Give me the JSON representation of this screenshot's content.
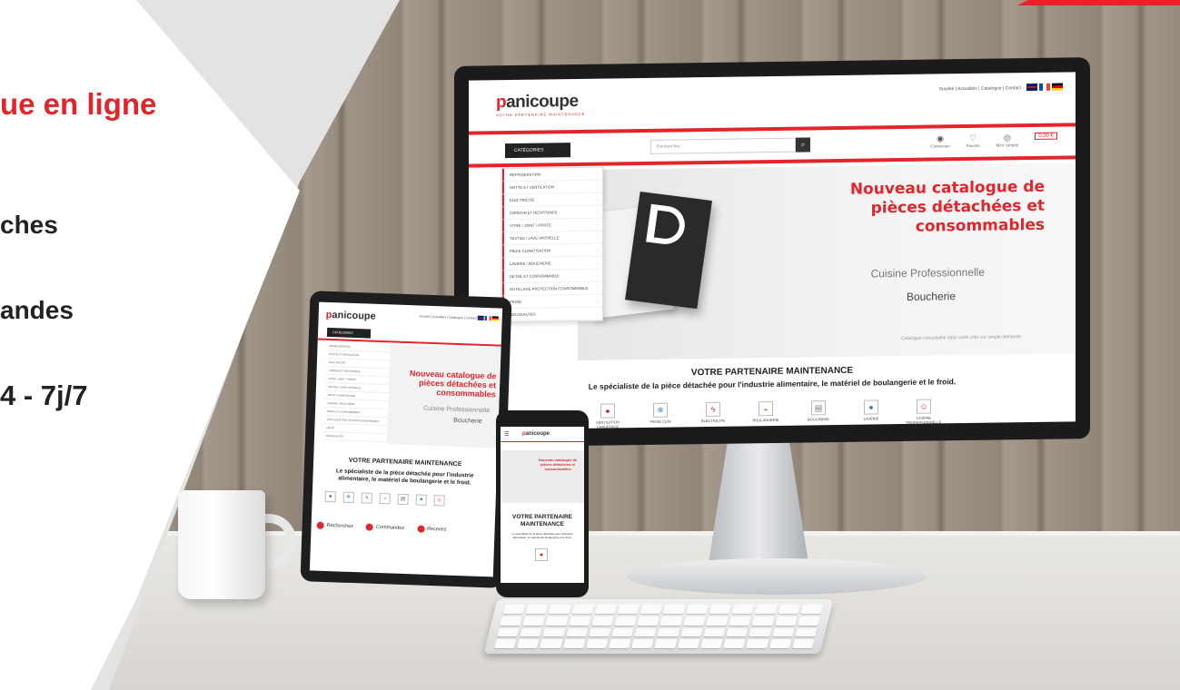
{
  "promo": {
    "line1": "ue en ligne",
    "line2": "ches",
    "line3": "andes",
    "line4": "4 - 7j/7"
  },
  "colors": {
    "brand_red": "#e2252b",
    "dark": "#222222"
  },
  "monitor": {
    "logo_main": "anicoupe",
    "logo_prefix": "p",
    "tagline": "VOTRE PARTENAIRE MAINTENANCE",
    "top_links": "Société | Actualités | Catalogue | Contact",
    "categories_button": "CATÉGORIES",
    "search_placeholder": "Rechercher...",
    "icons": [
      "Connexion",
      "Favoris",
      "Mon compte"
    ],
    "cart": "0,00 €",
    "menu": [
      "RÉFRIGÉRATION",
      "HOTTE ET VENTILATION",
      "ÉLECTRICITÉ",
      "CORDON ET RÉSISTANCE",
      "VITRE / JOINT / PORTE",
      "TEXTILE / LAVE-VAISSELLE",
      "PIÈCE CLIMATISATION",
      "LAVERIE / BOUCHERIE",
      "DÉTAIL ET CONSOMMABLE",
      "OUTILLAGE PROTECTION CONSOMMABLE",
      "FROID",
      "NOUVEAUTÉS"
    ],
    "banner_title": "Nouveau catalogue de pièces détachées et consommables",
    "banner_sub1": "Cuisine Professionnelle",
    "banner_sub2": "Boucherie",
    "banner_note": "Catalogue consultable dans votre colis sur simple demande",
    "partner_title": "VOTRE PARTENAIRE MAINTENANCE",
    "partner_desc": "Le spécialiste de la pièce détachée pour l'industrie alimentaire, le matériel de boulangerie et le froid.",
    "services": [
      {
        "label": "VENTILATION CHAUFFAGE",
        "icon": "flame-icon"
      },
      {
        "label": "FROID CLIM",
        "icon": "snowflake-icon"
      },
      {
        "label": "ÉLECTRICITÉ",
        "icon": "lightning-icon"
      },
      {
        "label": "BOULANGERIE",
        "icon": "bread-icon"
      },
      {
        "label": "BOUCHERIE",
        "icon": "meat-icon"
      },
      {
        "label": "LAVERIE",
        "icon": "water-drop-icon"
      },
      {
        "label": "CUISINE PROFESSIONNELLE",
        "icon": "chef-icon"
      }
    ]
  },
  "tablet": {
    "logo_main": "anicoupe",
    "logo_prefix": "p",
    "links": "Société | Actualités | Catalogue | Contact",
    "categories_button": "CATÉGORIES",
    "menu": [
      "RÉFRIGÉRATION",
      "HOTTE ET VENTILATION",
      "ÉLECTRICITÉ",
      "CORDON ET RÉSISTANCE",
      "VITRE / JOINT / PORTE",
      "TEXTILE / LAVE-VAISSELLE",
      "PIÈCE CLIMATISATION",
      "LAVERIE / BOUCHERIE",
      "DÉTAIL ET CONSOMMABLE",
      "OUTILLAGE PROTECTION CONSOMMABLE",
      "FROID",
      "NOUVEAUTÉS"
    ],
    "banner_title": "Nouveau catalogue de pièces détachées et consommables",
    "banner_sub1": "Cuisine Professionnelle",
    "banner_sub2": "Boucherie",
    "partner_title": "VOTRE PARTENAIRE MAINTENANCE",
    "partner_desc": "Le spécialiste de la pièce détachée pour l'industrie alimentaire, le matériel de boulangerie et le froid.",
    "steps": [
      "Recherchez",
      "Commandez",
      "Recevez"
    ]
  },
  "phone": {
    "logo_main": "anicoupe",
    "logo_prefix": "p",
    "banner_title": "Nouveau catalogue de pièces détachées et consommables",
    "partner_title": "VOTRE PARTENAIRE MAINTENANCE",
    "partner_desc": "Le spécialiste de la pièce détachée pour l'industrie alimentaire, le matériel de boulangerie et le froid."
  }
}
